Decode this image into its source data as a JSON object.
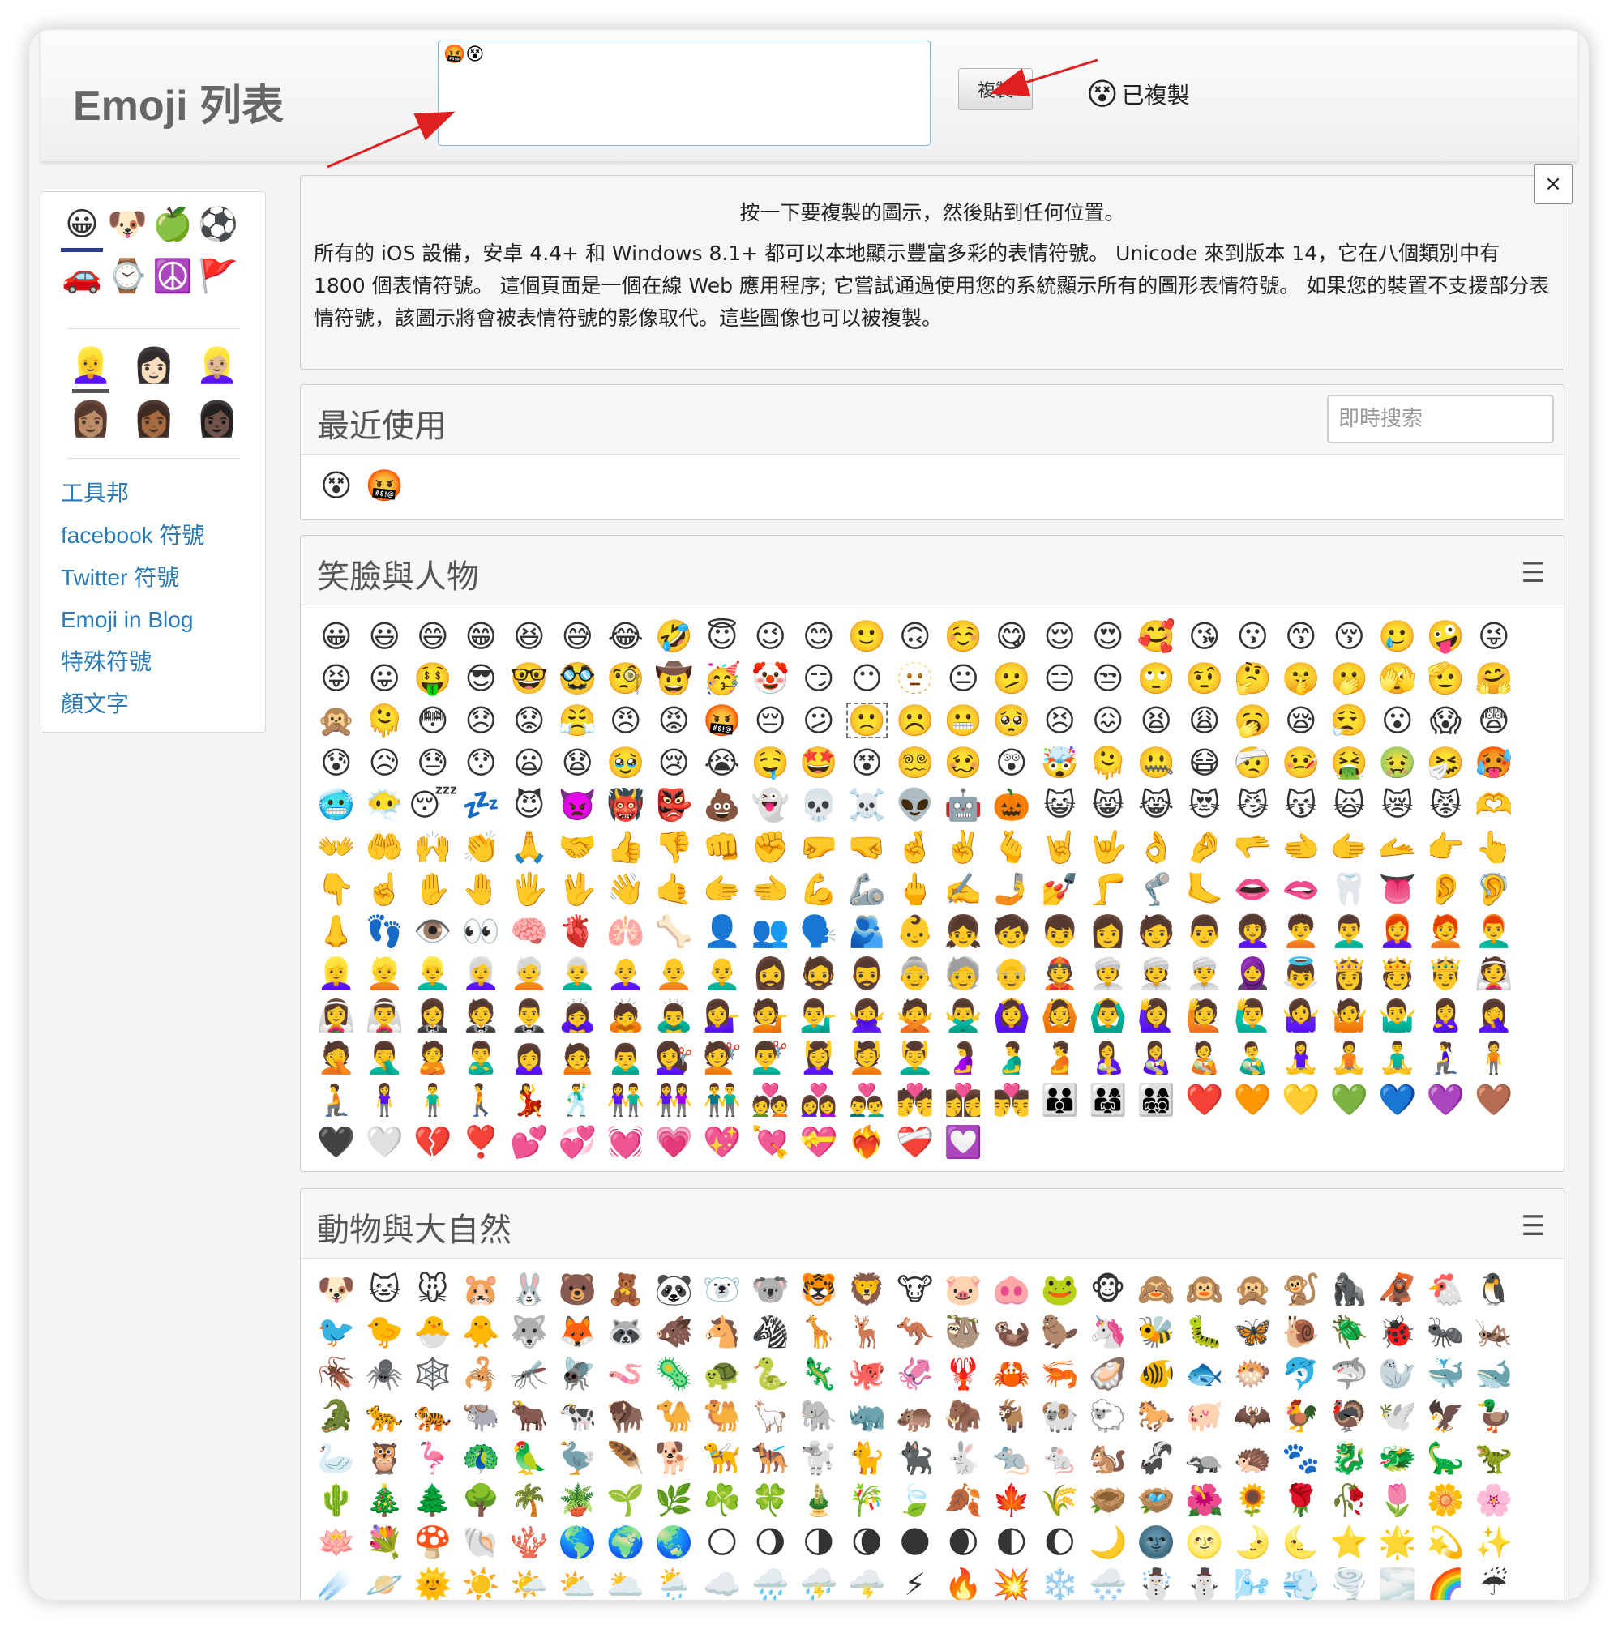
{
  "header": {
    "brand": "Emoji 列表",
    "copy_text": "🤬😵",
    "copy_button": "複製",
    "copied_emoji": "😵",
    "copied_label": "已複製"
  },
  "sidebar": {
    "categories": [
      "😀",
      "🐶",
      "🍏",
      "⚽",
      "🚗",
      "⌚",
      "☮️",
      "🚩"
    ],
    "skins": [
      "👱‍♀️",
      "👩🏻",
      "👱🏼‍♀️",
      "👩🏽",
      "👩🏾",
      "👩🏿"
    ],
    "links": [
      "工具邦",
      "facebook 符號",
      "Twitter 符號",
      "Emoji in Blog",
      "特殊符號",
      "顏文字"
    ]
  },
  "info": {
    "close": "×",
    "line1": "按一下要複製的圖示，然後貼到任何位置。",
    "line2": "所有的 iOS 設備，安卓 4.4+ 和 Windows 8.1+ 都可以本地顯示豐富多彩的表情符號。 Unicode 來到版本 14，它在八個類別中有 1800 個表情符號。 這個頁面是一個在線 Web 應用程序; 它嘗試通過使用您的系統顯示所有的圖形表情符號。 如果您的裝置不支援部分表情符號，該圖示將會被表情符號的影像取代。這些圖像也可以被複製。"
  },
  "recent": {
    "title": "最近使用",
    "search_placeholder": "即時搜索",
    "items": [
      "😵",
      "🤬"
    ]
  },
  "smileys": {
    "title": "笑臉與人物",
    "menu": "☰",
    "items": [
      "😀",
      "😃",
      "😄",
      "😁",
      "😆",
      "😅",
      "😂",
      "🤣",
      "😇",
      "😉",
      "😊",
      "🙂",
      "🙃",
      "☺️",
      "😋",
      "😌",
      "😍",
      "🥰",
      "😘",
      "😗",
      "😙",
      "😚",
      "🥲",
      "🤪",
      "😜",
      "😝",
      "😛",
      "🤑",
      "😎",
      "🤓",
      "🥸",
      "🧐",
      "🤠",
      "🥳",
      "🤡",
      "😏",
      "😶",
      "🫥",
      "😐",
      "🫤",
      "😑",
      "😒",
      "🙄",
      "🤨",
      "🤔",
      "🤫",
      "🫢",
      "🫣",
      "🫡",
      "🤗",
      "🙊",
      "🫠",
      "😳",
      "😞",
      "😟",
      "😤",
      "😠",
      "😡",
      "🤬",
      "😔",
      "😕",
      "🙁",
      "☹️",
      "😬",
      "🥺",
      "😣",
      "😖",
      "😫",
      "😩",
      "🥱",
      "😪",
      "😮‍💨",
      "😮",
      "😱",
      "😨",
      "😰",
      "😥",
      "😓",
      "😯",
      "😦",
      "😧",
      "🥹",
      "😢",
      "😭",
      "🤤",
      "🤩",
      "😵",
      "😵‍💫",
      "🥴",
      "😲",
      "🤯",
      "🫠",
      "🤐",
      "😷",
      "🤕",
      "🤒",
      "🤮",
      "🤢",
      "🤧",
      "🥵",
      "🥶",
      "😶‍🌫️",
      "😴",
      "💤",
      "😈",
      "👿",
      "👹",
      "👺",
      "💩",
      "👻",
      "💀",
      "☠️",
      "👽",
      "🤖",
      "🎃",
      "😺",
      "😸",
      "😹",
      "😻",
      "😼",
      "😽",
      "🙀",
      "😿",
      "😾",
      "🫶",
      "👐",
      "🤲",
      "🙌",
      "👏",
      "🙏",
      "🤝",
      "👍",
      "👎",
      "👊",
      "✊",
      "🤛",
      "🤜",
      "🤞",
      "✌️",
      "🫰",
      "🤘",
      "🤟",
      "👌",
      "🤌",
      "🫳",
      "🫲",
      "🫱",
      "🫴",
      "👉",
      "👆",
      "👇",
      "☝️",
      "✋",
      "🤚",
      "🖐️",
      "🖖",
      "👋",
      "🤙",
      "🫱",
      "🫲",
      "💪",
      "🦾",
      "🖕",
      "✍️",
      "🤳",
      "💅",
      "🦵",
      "🦿",
      "🦶",
      "👄",
      "🫦",
      "🦷",
      "👅",
      "👂",
      "🦻",
      "👃",
      "👣",
      "👁️",
      "👀",
      "🧠",
      "🫀",
      "🫁",
      "🦴",
      "👤",
      "👥",
      "🗣️",
      "🫂",
      "👶",
      "👧",
      "🧒",
      "👦",
      "👩",
      "🧑",
      "👨",
      "👩‍🦱",
      "🧑‍🦱",
      "👨‍🦱",
      "👩‍🦰",
      "🧑‍🦰",
      "👨‍🦰",
      "👱‍♀️",
      "👱",
      "👱‍♂️",
      "👩‍🦳",
      "🧑‍🦳",
      "👨‍🦳",
      "👩‍🦲",
      "🧑‍🦲",
      "👨‍🦲",
      "🧔‍♀️",
      "🧔",
      "🧔‍♂️",
      "👵",
      "🧓",
      "👴",
      "👲",
      "👳‍♀️",
      "👳",
      "👳‍♂️",
      "🧕",
      "👼",
      "👸",
      "🫅",
      "🤴",
      "👰",
      "👰‍♀️",
      "👰‍♂️",
      "🤵‍♀️",
      "🤵",
      "🤵‍♂️",
      "🙇‍♀️",
      "🙇",
      "🙇‍♂️",
      "💁‍♀️",
      "💁",
      "💁‍♂️",
      "🙅‍♀️",
      "🙅",
      "🙅‍♂️",
      "🙆‍♀️",
      "🙆",
      "🙆‍♂️",
      "🙋‍♀️",
      "🙋",
      "🙋‍♂️",
      "🤷‍♀️",
      "🤷",
      "🤷‍♂️",
      "🙎‍♀️",
      "🤦‍♀️",
      "🤦",
      "🤦‍♂️",
      "🙎",
      "🙎‍♂️",
      "🙍‍♀️",
      "🙍",
      "🙍‍♂️",
      "💇‍♀️",
      "💇",
      "💇‍♂️",
      "💆‍♀️",
      "💆",
      "💆‍♂️",
      "🤰",
      "🫃",
      "🫄",
      "🤱",
      "👩‍🍼",
      "🧑‍🍼",
      "👨‍🍼",
      "🧘‍♀️",
      "🧘",
      "🧘‍♂️",
      "🧎‍♀️",
      "🧍",
      "🧎",
      "🧍‍♀️",
      "🧍‍♂️",
      "🚶",
      "💃",
      "🕺",
      "👫",
      "👭",
      "👬",
      "💑",
      "👩‍❤️‍👩",
      "👨‍❤️‍👨",
      "💏",
      "👩‍❤️‍💋‍👩",
      "👨‍❤️‍💋‍👨",
      "👪",
      "👨‍👩‍👧",
      "👨‍👩‍👧‍👦",
      "❤️",
      "🧡",
      "💛",
      "💚",
      "💙",
      "💜",
      "🤎",
      "🖤",
      "🤍",
      "💔",
      "❣️",
      "💕",
      "💞",
      "💓",
      "💗",
      "💖",
      "💘",
      "💝",
      "❤️‍🔥",
      "❤️‍🩹",
      "💟"
    ]
  },
  "animals": {
    "title": "動物與大自然",
    "menu": "☰",
    "items": [
      "🐶",
      "🐱",
      "🐭",
      "🐹",
      "🐰",
      "🐻",
      "🧸",
      "🐼",
      "🐻‍❄️",
      "🐨",
      "🐯",
      "🦁",
      "🐮",
      "🐷",
      "🐽",
      "🐸",
      "🐵",
      "🙈",
      "🙉",
      "🙊",
      "🐒",
      "🦍",
      "🦧",
      "🐔",
      "🐧",
      "🐦",
      "🐤",
      "🐣",
      "🐥",
      "🐺",
      "🦊",
      "🦝",
      "🐗",
      "🐴",
      "🦓",
      "🦒",
      "🦌",
      "🦘",
      "🦥",
      "🦦",
      "🦫",
      "🦄",
      "🐝",
      "🐛",
      "🦋",
      "🐌",
      "🪲",
      "🐞",
      "🐜",
      "🦗",
      "🪳",
      "🕷️",
      "🕸️",
      "🦂",
      "🦟",
      "🪰",
      "🪱",
      "🦠",
      "🐢",
      "🐍",
      "🦎",
      "🐙",
      "🦑",
      "🦞",
      "🦀",
      "🦐",
      "🦪",
      "🐠",
      "🐟",
      "🐡",
      "🐬",
      "🦈",
      "🦭",
      "🐳",
      "🐋",
      "🐊",
      "🐆",
      "🐅",
      "🐃",
      "🐂",
      "🐄",
      "🦬",
      "🐪",
      "🐫",
      "🦙",
      "🐘",
      "🦏",
      "🦛",
      "🦣",
      "🐐",
      "🐏",
      "🐑",
      "🐎",
      "🐖",
      "🦇",
      "🐓",
      "🦃",
      "🕊️",
      "🦅",
      "🦆",
      "🦢",
      "🦉",
      "🦩",
      "🦚",
      "🦜",
      "🦤",
      "🪶",
      "🐕",
      "🦮",
      "🐕‍🦺",
      "🐩",
      "🐈",
      "🐈‍⬛",
      "🐇",
      "🐀",
      "🐁",
      "🐿️",
      "🦨",
      "🦡",
      "🦔",
      "🐾",
      "🐉",
      "🐲",
      "🦕",
      "🦖",
      "🌵",
      "🎄",
      "🌲",
      "🌳",
      "🌴",
      "🪴",
      "🌱",
      "🌿",
      "☘️",
      "🍀",
      "🎍",
      "🎋",
      "🍃",
      "🍂",
      "🍁",
      "🌾",
      "🪹",
      "🪺",
      "🌺",
      "🌻",
      "🌹",
      "🥀",
      "🌷",
      "🌼",
      "🌸",
      "🪷",
      "💐",
      "🍄",
      "🐚",
      "🪸",
      "🌎",
      "🌍",
      "🌏",
      "🌕",
      "🌖",
      "🌗",
      "🌘",
      "🌑",
      "🌒",
      "🌓",
      "🌔",
      "🌙",
      "🌚",
      "🌝",
      "🌛",
      "🌜",
      "⭐",
      "🌟",
      "💫",
      "✨",
      "☄️",
      "🪐",
      "🌞",
      "☀️",
      "🌤️",
      "⛅",
      "🌥️",
      "🌦️",
      "☁️",
      "🌧️",
      "⛈️",
      "🌩️",
      "⚡",
      "🔥",
      "💥",
      "❄️",
      "🌨️",
      "☃️",
      "⛄",
      "🌬️",
      "💨",
      "🌪️",
      "🌫️",
      "🌈",
      "☔"
    ]
  }
}
